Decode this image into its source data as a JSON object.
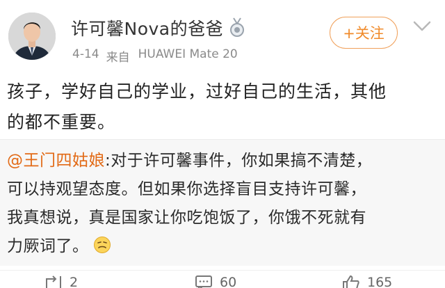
{
  "post": {
    "author": "许可馨Nova的爸爸",
    "date": "4-14",
    "source_prefix": "来自",
    "device": "HUAWEI Mate 20",
    "follow_label": "+关注",
    "text_line1": "孩子，学好自己的学业，过好自己的生活，其他",
    "text_line2": "的都不重要。"
  },
  "repost": {
    "mention": "@王门四姑娘",
    "line1": ":对于许可馨事件，你如果搞不清楚，",
    "line2": "可以持观望态度。但如果你选择盲目支持许可馨，",
    "line3": "我真想说，真是国家让你吃饱饭了，你饿不死就有",
    "line4": "力厥词了。"
  },
  "actions": {
    "repost_count": "2",
    "comment_count": "60",
    "like_count": "165"
  },
  "colors": {
    "accent_orange": "#f08a2a",
    "mention_orange": "#e26a16",
    "meta_gray": "#8a8a8a"
  },
  "icons": [
    "avatar-photo",
    "medal-badge-icon",
    "chevron-down-icon",
    "emoji-face-icon",
    "repost-icon",
    "comment-icon",
    "like-icon"
  ]
}
